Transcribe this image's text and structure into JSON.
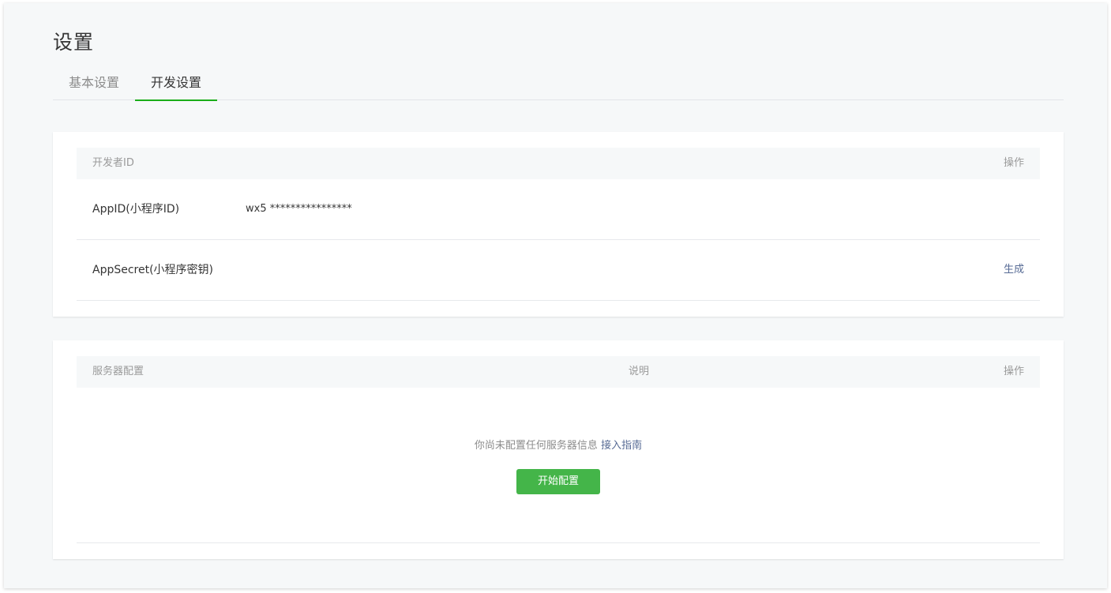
{
  "page": {
    "title": "设置"
  },
  "tabs": [
    {
      "label": "基本设置",
      "active": false
    },
    {
      "label": "开发设置",
      "active": true
    }
  ],
  "developer_id": {
    "header": {
      "left": "开发者ID",
      "right": "操作"
    },
    "rows": [
      {
        "label": "AppID(小程序ID)",
        "value": "wx5 ****************",
        "action": ""
      },
      {
        "label": "AppSecret(小程序密钥)",
        "value": "",
        "action": "生成"
      }
    ]
  },
  "server_config": {
    "header": {
      "left": "服务器配置",
      "middle": "说明",
      "right": "操作"
    },
    "empty_text": "你尚未配置任何服务器信息",
    "guide_link": "接入指南",
    "start_button": "开始配置"
  },
  "colors": {
    "accent": "#1aad19",
    "button": "#44b549",
    "link": "#576b95"
  }
}
